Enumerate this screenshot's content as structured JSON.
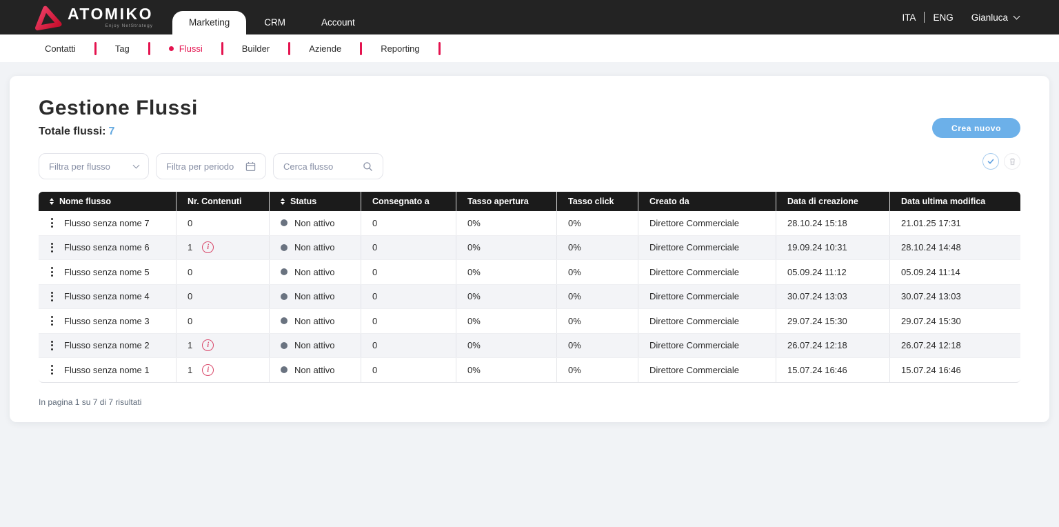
{
  "topbar": {
    "brand": "ATOMIKO",
    "tagline": "Enjoy NetStrategy",
    "tabs": [
      {
        "label": "Marketing",
        "active": true
      },
      {
        "label": "CRM",
        "active": false
      },
      {
        "label": "Account",
        "active": false
      }
    ],
    "languages": {
      "ita": "ITA",
      "eng": "ENG"
    },
    "user_name": "Gianluca"
  },
  "subnav": {
    "items": [
      {
        "label": "Contatti",
        "active": false
      },
      {
        "label": "Tag",
        "active": false
      },
      {
        "label": "Flussi",
        "active": true
      },
      {
        "label": "Builder",
        "active": false
      },
      {
        "label": "Aziende",
        "active": false
      },
      {
        "label": "Reporting",
        "active": false
      }
    ]
  },
  "page": {
    "title": "Gestione Flussi",
    "total_label": "Totale flussi:",
    "total_value": "7",
    "create_button_label": "Crea nuovo"
  },
  "filters": {
    "flow_filter_label": "Filtra per flusso",
    "period_filter_label": "Filtra per periodo",
    "search_placeholder": "Cerca flusso"
  },
  "table": {
    "columns": [
      {
        "label": "Nome flusso",
        "sortable": true
      },
      {
        "label": "Nr. Contenuti",
        "sortable": false
      },
      {
        "label": "Status",
        "sortable": true
      },
      {
        "label": "Consegnato a",
        "sortable": false
      },
      {
        "label": "Tasso apertura",
        "sortable": false
      },
      {
        "label": "Tasso click",
        "sortable": false
      },
      {
        "label": "Creato da",
        "sortable": false
      },
      {
        "label": "Data di creazione",
        "sortable": false
      },
      {
        "label": "Data ultima modifica",
        "sortable": false
      }
    ],
    "rows": [
      {
        "name": "Flusso senza nome 7",
        "contenuti": "0",
        "has_info": false,
        "status": "Non attivo",
        "consegnato": "0",
        "tasso_apertura": "0%",
        "tasso_click": "0%",
        "creato_da": "Direttore Commerciale",
        "creazione": "28.10.24 15:18",
        "modifica": "21.01.25 17:31"
      },
      {
        "name": "Flusso senza nome 6",
        "contenuti": "1",
        "has_info": true,
        "status": "Non attivo",
        "consegnato": "0",
        "tasso_apertura": "0%",
        "tasso_click": "0%",
        "creato_da": "Direttore Commerciale",
        "creazione": "19.09.24 10:31",
        "modifica": "28.10.24 14:48"
      },
      {
        "name": "Flusso senza nome 5",
        "contenuti": "0",
        "has_info": false,
        "status": "Non attivo",
        "consegnato": "0",
        "tasso_apertura": "0%",
        "tasso_click": "0%",
        "creato_da": "Direttore Commerciale",
        "creazione": "05.09.24 11:12",
        "modifica": "05.09.24 11:14"
      },
      {
        "name": "Flusso senza nome 4",
        "contenuti": "0",
        "has_info": false,
        "status": "Non attivo",
        "consegnato": "0",
        "tasso_apertura": "0%",
        "tasso_click": "0%",
        "creato_da": "Direttore Commerciale",
        "creazione": "30.07.24 13:03",
        "modifica": "30.07.24 13:03"
      },
      {
        "name": "Flusso senza nome 3",
        "contenuti": "0",
        "has_info": false,
        "status": "Non attivo",
        "consegnato": "0",
        "tasso_apertura": "0%",
        "tasso_click": "0%",
        "creato_da": "Direttore Commerciale",
        "creazione": "29.07.24 15:30",
        "modifica": "29.07.24 15:30"
      },
      {
        "name": "Flusso senza nome 2",
        "contenuti": "1",
        "has_info": true,
        "status": "Non attivo",
        "consegnato": "0",
        "tasso_apertura": "0%",
        "tasso_click": "0%",
        "creato_da": "Direttore Commerciale",
        "creazione": "26.07.24 12:18",
        "modifica": "26.07.24 12:18"
      },
      {
        "name": "Flusso senza nome 1",
        "contenuti": "1",
        "has_info": true,
        "status": "Non attivo",
        "consegnato": "0",
        "tasso_apertura": "0%",
        "tasso_click": "0%",
        "creato_da": "Direttore Commerciale",
        "creazione": "15.07.24 16:46",
        "modifica": "15.07.24 16:46"
      }
    ],
    "pagination_text": "In pagina 1 su 7 di 7 risultati"
  },
  "colors": {
    "accent_red": "#E4134F",
    "accent_blue": "#6CB0E9",
    "topbar_bg": "#232323",
    "table_header_bg": "#1B1B1B",
    "status_dot": "#6A7380",
    "info_icon": "#D9486A",
    "page_bg": "#F1F3F6"
  }
}
